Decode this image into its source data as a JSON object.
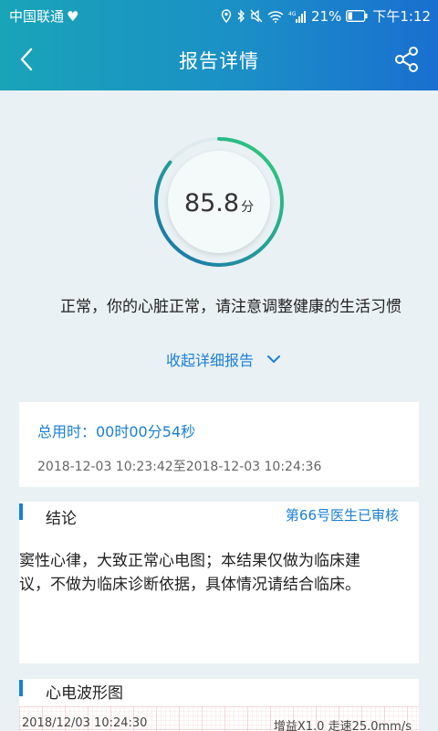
{
  "status_bar": {
    "carrier": "中国联通",
    "battery": "21%",
    "time": "下午1:12",
    "network": "4G"
  },
  "nav": {
    "title": "报告详情",
    "back_icon": "chevron-left-icon",
    "share_icon": "share-icon"
  },
  "score": {
    "value": "85.8",
    "unit": "分",
    "fraction": 0.858
  },
  "summary": "正常，你的心脏正常，请注意调整健康的生活习惯",
  "collapse_label": "收起详细报告",
  "duration": {
    "total": "总用时：00时00分54秒",
    "range": "2018-12-03 10:23:42至2018-12-03 10:24:36"
  },
  "conclusion": {
    "title": "结论",
    "reviewer": "第66号医生已审核",
    "line1": "窦性心律，大致正常心电图；本结果仅做为临床建",
    "line2": "议，不做为临床诊断依据，具体情况请结合临床。"
  },
  "ecg": {
    "title": "心电波形图",
    "timestamp": "2018/12/03 10:24:30",
    "gain_speed": "增益X1.0 走速25.0mm/s"
  },
  "colors": {
    "header_start": "#19a4b8",
    "header_end": "#1a6fd0",
    "accent": "#1a7fd4",
    "gauge_start": "#1a6fb0",
    "gauge_end": "#2fd07a"
  }
}
